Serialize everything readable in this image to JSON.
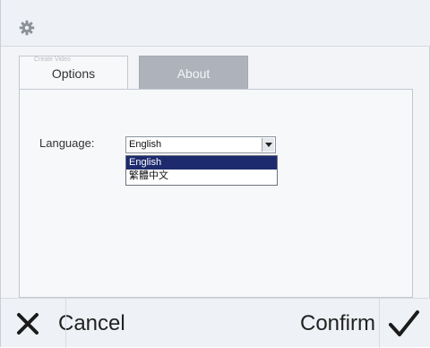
{
  "window": {
    "icon": "gear-icon"
  },
  "tabs": [
    {
      "label": "Options",
      "active": true,
      "ghost_label": "Create Video"
    },
    {
      "label": "About",
      "active": false
    }
  ],
  "options": {
    "language_label": "Language:",
    "language_value": "English",
    "language_options": [
      "English",
      "繁體中文"
    ]
  },
  "actions": {
    "cancel_label": "Cancel",
    "confirm_label": "Confirm"
  },
  "colors": {
    "selected_option_bg": "#1d2a6e",
    "inactive_tab_bg": "#aeb3bb"
  }
}
